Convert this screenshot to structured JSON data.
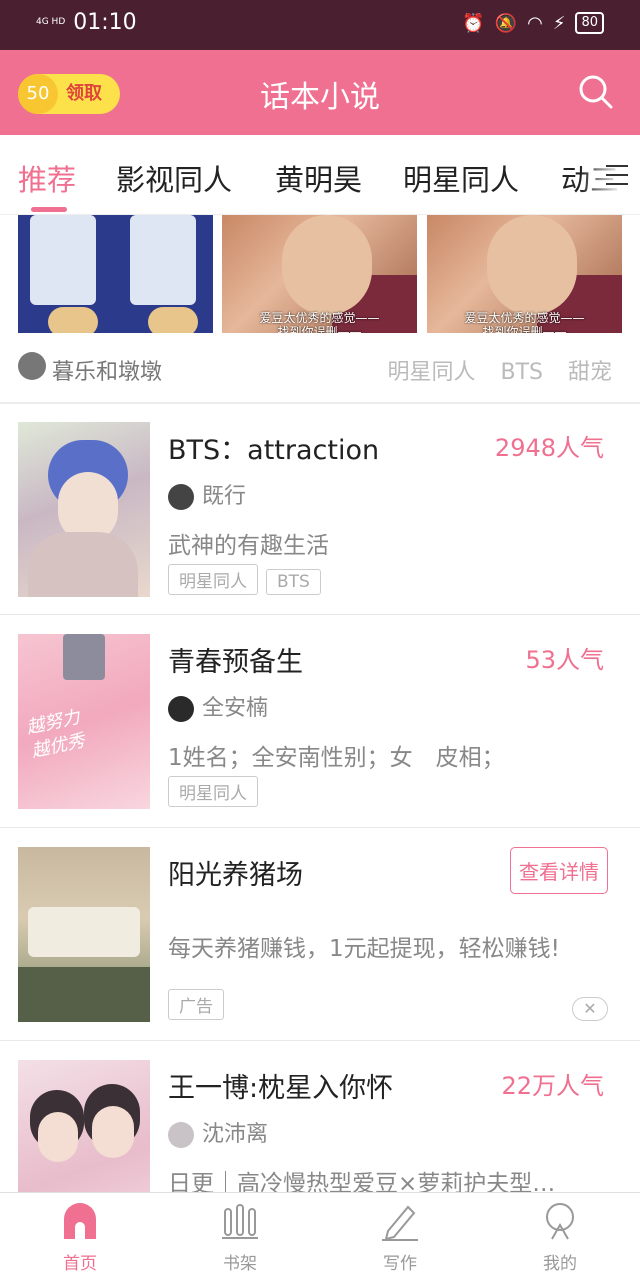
{
  "status": {
    "network": "4G HD",
    "time": "01:10",
    "battery": "80"
  },
  "header": {
    "coin_amount": "50",
    "coin_label": "领取",
    "title": "话本小说"
  },
  "tabs": [
    "推荐",
    "影视同人",
    "黄明昊",
    "明星同人",
    "动三"
  ],
  "banner": {
    "caption_line1": "爱豆太优秀的感觉——",
    "caption_line2": "找到你误删——",
    "author": "暮乐和墩墩",
    "tags": [
      "明星同人",
      "BTS",
      "甜宠"
    ]
  },
  "cards": [
    {
      "title": "BTS：attraction",
      "popularity": "2948人气",
      "author": "既行",
      "description": "武神的有趣生活",
      "tags": [
        "明星同人",
        "BTS"
      ]
    },
    {
      "title": "青春预备生",
      "popularity": "53人气",
      "author": "全安楠",
      "description": "1姓名；全安南性别；女　皮相；",
      "tags": [
        "明星同人"
      ],
      "cover_text": [
        "越努力",
        "越优秀"
      ]
    },
    {
      "title": "阳光养猪场",
      "button": "查看详情",
      "description": "每天养猪赚钱，1元起提现，轻松赚钱!",
      "tags": [
        "广告"
      ],
      "close": "✕"
    },
    {
      "title": "王一博:枕星入你怀",
      "popularity": "22万人气",
      "author": "沈沛离",
      "description": "日更｜高冷慢热型爱豆×萝莉护夫型…",
      "tags": []
    }
  ],
  "bottom_nav": [
    {
      "label": "首页",
      "icon": "home-icon"
    },
    {
      "label": "书架",
      "icon": "bookshelf-icon"
    },
    {
      "label": "写作",
      "icon": "pen-icon"
    },
    {
      "label": "我的",
      "icon": "profile-icon"
    }
  ],
  "colors": {
    "accent": "#ef7090",
    "status_bar": "#4a2030"
  }
}
